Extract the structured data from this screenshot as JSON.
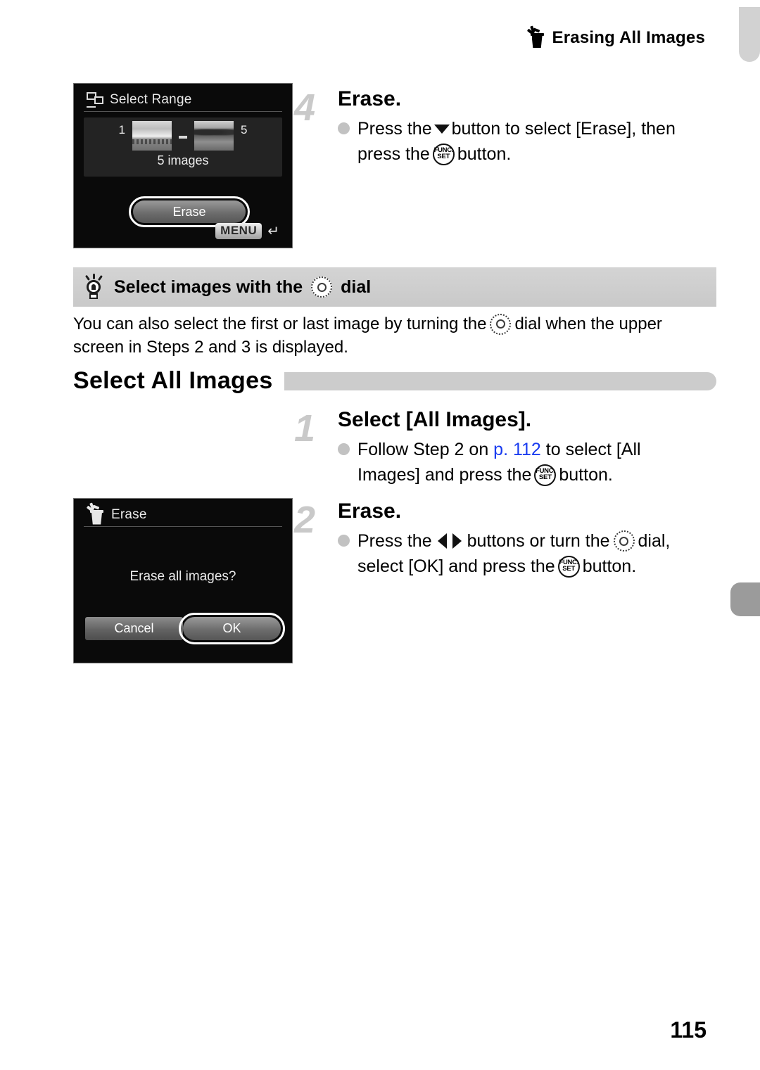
{
  "header": {
    "icon": "trash-erase-icon",
    "title": "Erasing All Images"
  },
  "screens": {
    "select_range": {
      "title_icon": "select-range-icon",
      "title": "Select Range",
      "first_index": "1",
      "last_index": "5",
      "range_dash": "—",
      "count_label": "5 images",
      "action_button": "Erase",
      "menu_chip": "MENU",
      "return_icon": "return-arrow-icon"
    },
    "erase_all": {
      "title_icon": "trash-erase-icon",
      "title": "Erase",
      "message": "Erase all images?",
      "cancel_button": "Cancel",
      "ok_button": "OK"
    }
  },
  "tip": {
    "icon": "lightbulb-icon",
    "title_before": "Select images with the",
    "title_dial_icon": "dial-icon",
    "title_after": "dial",
    "body_line1_before": "You can also select the first or last image by turning the",
    "body_line1_dial_icon": "dial-icon",
    "body_line1_after": "dial when the upper",
    "body_line2": "screen in Steps 2 and 3 is displayed."
  },
  "section": {
    "heading": "Select All Images"
  },
  "steps": [
    {
      "number": "4",
      "title": "Erase.",
      "line1_before": "Press the",
      "line1_arrow_icon": "arrow-down-icon",
      "line1_after": "button to select [Erase], then",
      "line2_before": "press the",
      "line2_func_icon": "func-set-icon",
      "line2_after": "button."
    },
    {
      "number": "1",
      "title": "Select [All Images].",
      "line1_before": "Follow Step 2 on",
      "line1_link": "p. 112",
      "line1_after": "to select [All",
      "line2_before": "Images] and press the",
      "line2_func_icon": "func-set-icon",
      "line2_after": "button."
    },
    {
      "number": "2",
      "title": "Erase.",
      "line1_before": "Press the",
      "line1_arrows_icon": "arrow-left-right-icon",
      "line1_mid": "buttons or turn the",
      "line1_dial_icon": "dial-icon",
      "line1_after": "dial,",
      "line2_before": "select [OK] and press the",
      "line2_func_icon": "func-set-icon",
      "line2_after": "button."
    }
  ],
  "footer": {
    "page_number": "115"
  },
  "colors": {
    "link": "#1a3cf0",
    "tip_band": "#cfcfcf",
    "section_bar": "#cccccc",
    "step_number": "#c9c9c9",
    "edge_tab_top": "#d2d2d2",
    "edge_tab_mid": "#9b9b9b"
  }
}
